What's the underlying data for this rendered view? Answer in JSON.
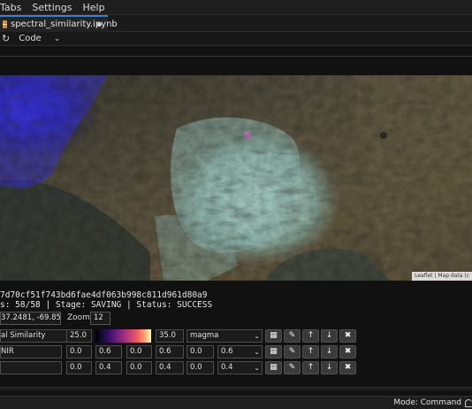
{
  "menu": {
    "items": [
      {
        "label": "Tabs"
      },
      {
        "label": "Settings"
      },
      {
        "label": "Help"
      }
    ]
  },
  "tab": {
    "label": "spectral_similarity.ipynb",
    "unsaved": true
  },
  "toolbar": {
    "cell_type": "Code",
    "restart_icon": "restart-icon"
  },
  "map": {
    "attribution": "Leaflet | Map data (c"
  },
  "output": {
    "hash_line": "7d70cf51f743bd6fae4df063b998c811d961d80a9",
    "status_line": "s: 58/58 | Stage: SAVING | Status: SUCCESS"
  },
  "controls": {
    "coords": "37.2481, -69.8514",
    "zoom_label": "Zoom:",
    "zoom_value": "12"
  },
  "layers": [
    {
      "name": "al Similarity",
      "min": "25.0",
      "max": "35.0",
      "palette": "magma",
      "has_colorbar": true
    },
    {
      "name": "NIR",
      "values": [
        "0.0",
        "0.6",
        "0.0",
        "0.6",
        "0.0",
        "0.6"
      ]
    },
    {
      "name": "",
      "values": [
        "0.0",
        "0.4",
        "0.0",
        "0.4",
        "0.0",
        "0.4"
      ]
    }
  ],
  "layer_buttons": [
    {
      "icon": "grid-icon",
      "glyph": "▦"
    },
    {
      "icon": "pencil-icon",
      "glyph": "✎"
    },
    {
      "icon": "arrow-up-icon",
      "glyph": "↑"
    },
    {
      "icon": "arrow-down-icon",
      "glyph": "↓"
    },
    {
      "icon": "close-icon",
      "glyph": "✖"
    }
  ],
  "statusbar": {
    "mode": "Mode: Command"
  },
  "colors": {
    "accent": "#3f7fd0",
    "notebook_icon": "#e2872b"
  }
}
